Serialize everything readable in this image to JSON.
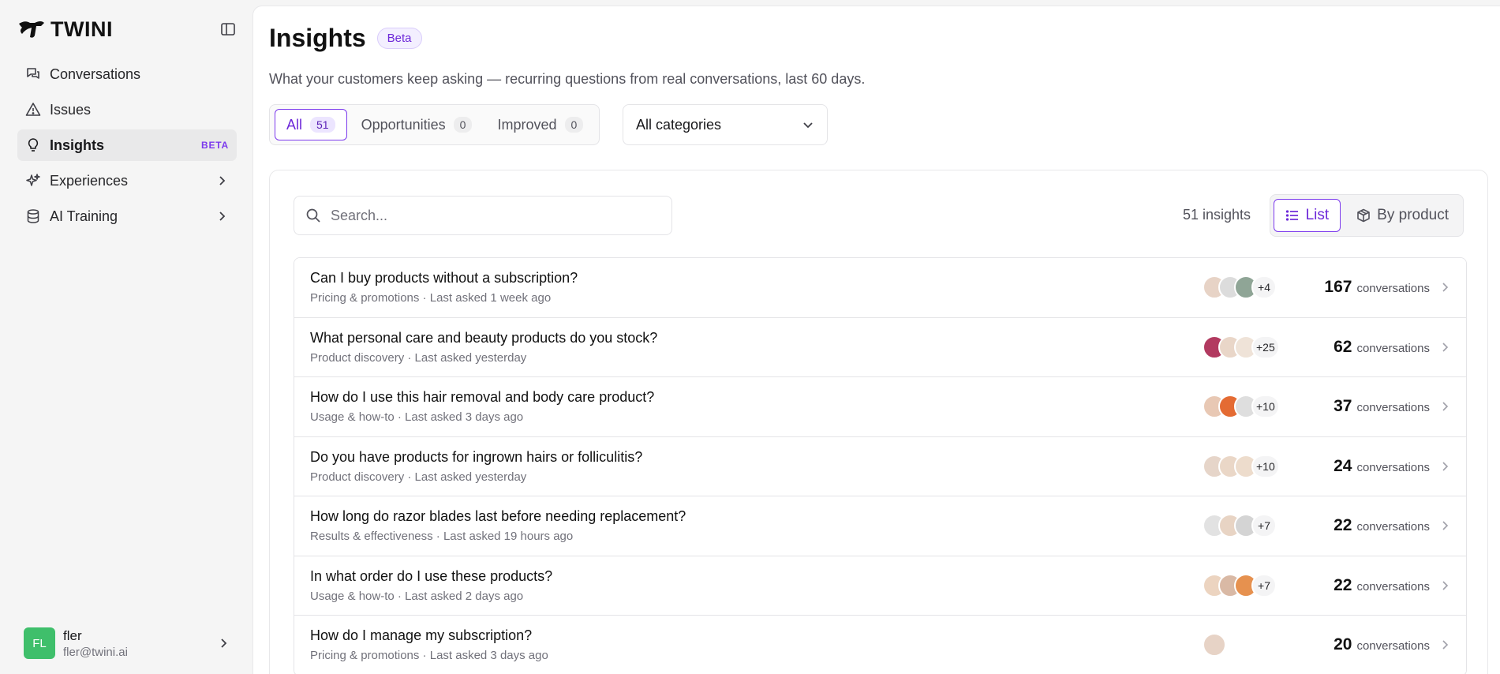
{
  "brand": {
    "name": "TWINI"
  },
  "sidebar": {
    "items": [
      {
        "label": "Conversations",
        "icon": "chat-icon",
        "active": false,
        "badge": "",
        "expandable": false
      },
      {
        "label": "Issues",
        "icon": "warning-triangle-icon",
        "active": false,
        "badge": "",
        "expandable": false
      },
      {
        "label": "Insights",
        "icon": "lightbulb-icon",
        "active": true,
        "badge": "BETA",
        "expandable": false
      },
      {
        "label": "Experiences",
        "icon": "sparkles-icon",
        "active": false,
        "badge": "",
        "expandable": true
      },
      {
        "label": "AI Training",
        "icon": "database-icon",
        "active": false,
        "badge": "",
        "expandable": true
      }
    ],
    "user": {
      "initials": "FL",
      "name": "fler",
      "email": "fler@twini.ai"
    }
  },
  "header": {
    "title": "Insights",
    "badge": "Beta",
    "subtitle": "What your customers keep asking — recurring questions from real conversations, last 60 days."
  },
  "tabs": [
    {
      "label": "All",
      "count": "51",
      "active": true
    },
    {
      "label": "Opportunities",
      "count": "0",
      "active": false
    },
    {
      "label": "Improved",
      "count": "0",
      "active": false
    }
  ],
  "category_filter": {
    "selected": "All categories"
  },
  "search": {
    "placeholder": "Search..."
  },
  "summary": {
    "count_label": "51 insights"
  },
  "view_toggle": {
    "list_label": "List",
    "product_label": "By product",
    "active": "list"
  },
  "colors": {
    "accent": "#7c3aed",
    "avatar": "#3fbf6b"
  },
  "insights": [
    {
      "question": "Can I buy products without a subscription?",
      "meta": "Pricing & promotions · Last asked 1 week ago",
      "more": "+4",
      "count": "167",
      "unit": "conversations",
      "thumbs": [
        "#e7d3c6",
        "#dcdcdc",
        "#8fa596"
      ]
    },
    {
      "question": "What personal care and beauty products do you stock?",
      "meta": "Product discovery · Last asked yesterday",
      "more": "+25",
      "count": "62",
      "unit": "conversations",
      "thumbs": [
        "#b23a60",
        "#e9d6c8",
        "#efe3d8"
      ]
    },
    {
      "question": "How do I use this hair removal and body care product?",
      "meta": "Usage & how-to · Last asked 3 days ago",
      "more": "+10",
      "count": "37",
      "unit": "conversations",
      "thumbs": [
        "#e8c8b4",
        "#e46b33",
        "#dedede"
      ]
    },
    {
      "question": "Do you have products for ingrown hairs or folliculitis?",
      "meta": "Product discovery · Last asked yesterday",
      "more": "+10",
      "count": "24",
      "unit": "conversations",
      "thumbs": [
        "#e6d5c9",
        "#ead7c7",
        "#eddccc"
      ]
    },
    {
      "question": "How long do razor blades last before needing replacement?",
      "meta": "Results & effectiveness · Last asked 19 hours ago",
      "more": "+7",
      "count": "22",
      "unit": "conversations",
      "thumbs": [
        "#e2e2e2",
        "#e8d4c4",
        "#d4d4d4"
      ]
    },
    {
      "question": "In what order do I use these products?",
      "meta": "Usage & how-to · Last asked 2 days ago",
      "more": "+7",
      "count": "22",
      "unit": "conversations",
      "thumbs": [
        "#ecd4c0",
        "#d9b9a5",
        "#e6914f"
      ]
    },
    {
      "question": "How do I manage my subscription?",
      "meta": "Pricing & promotions · Last asked 3 days ago",
      "more": "",
      "count": "20",
      "unit": "conversations",
      "thumbs": [
        "#e7d3c6"
      ]
    }
  ]
}
